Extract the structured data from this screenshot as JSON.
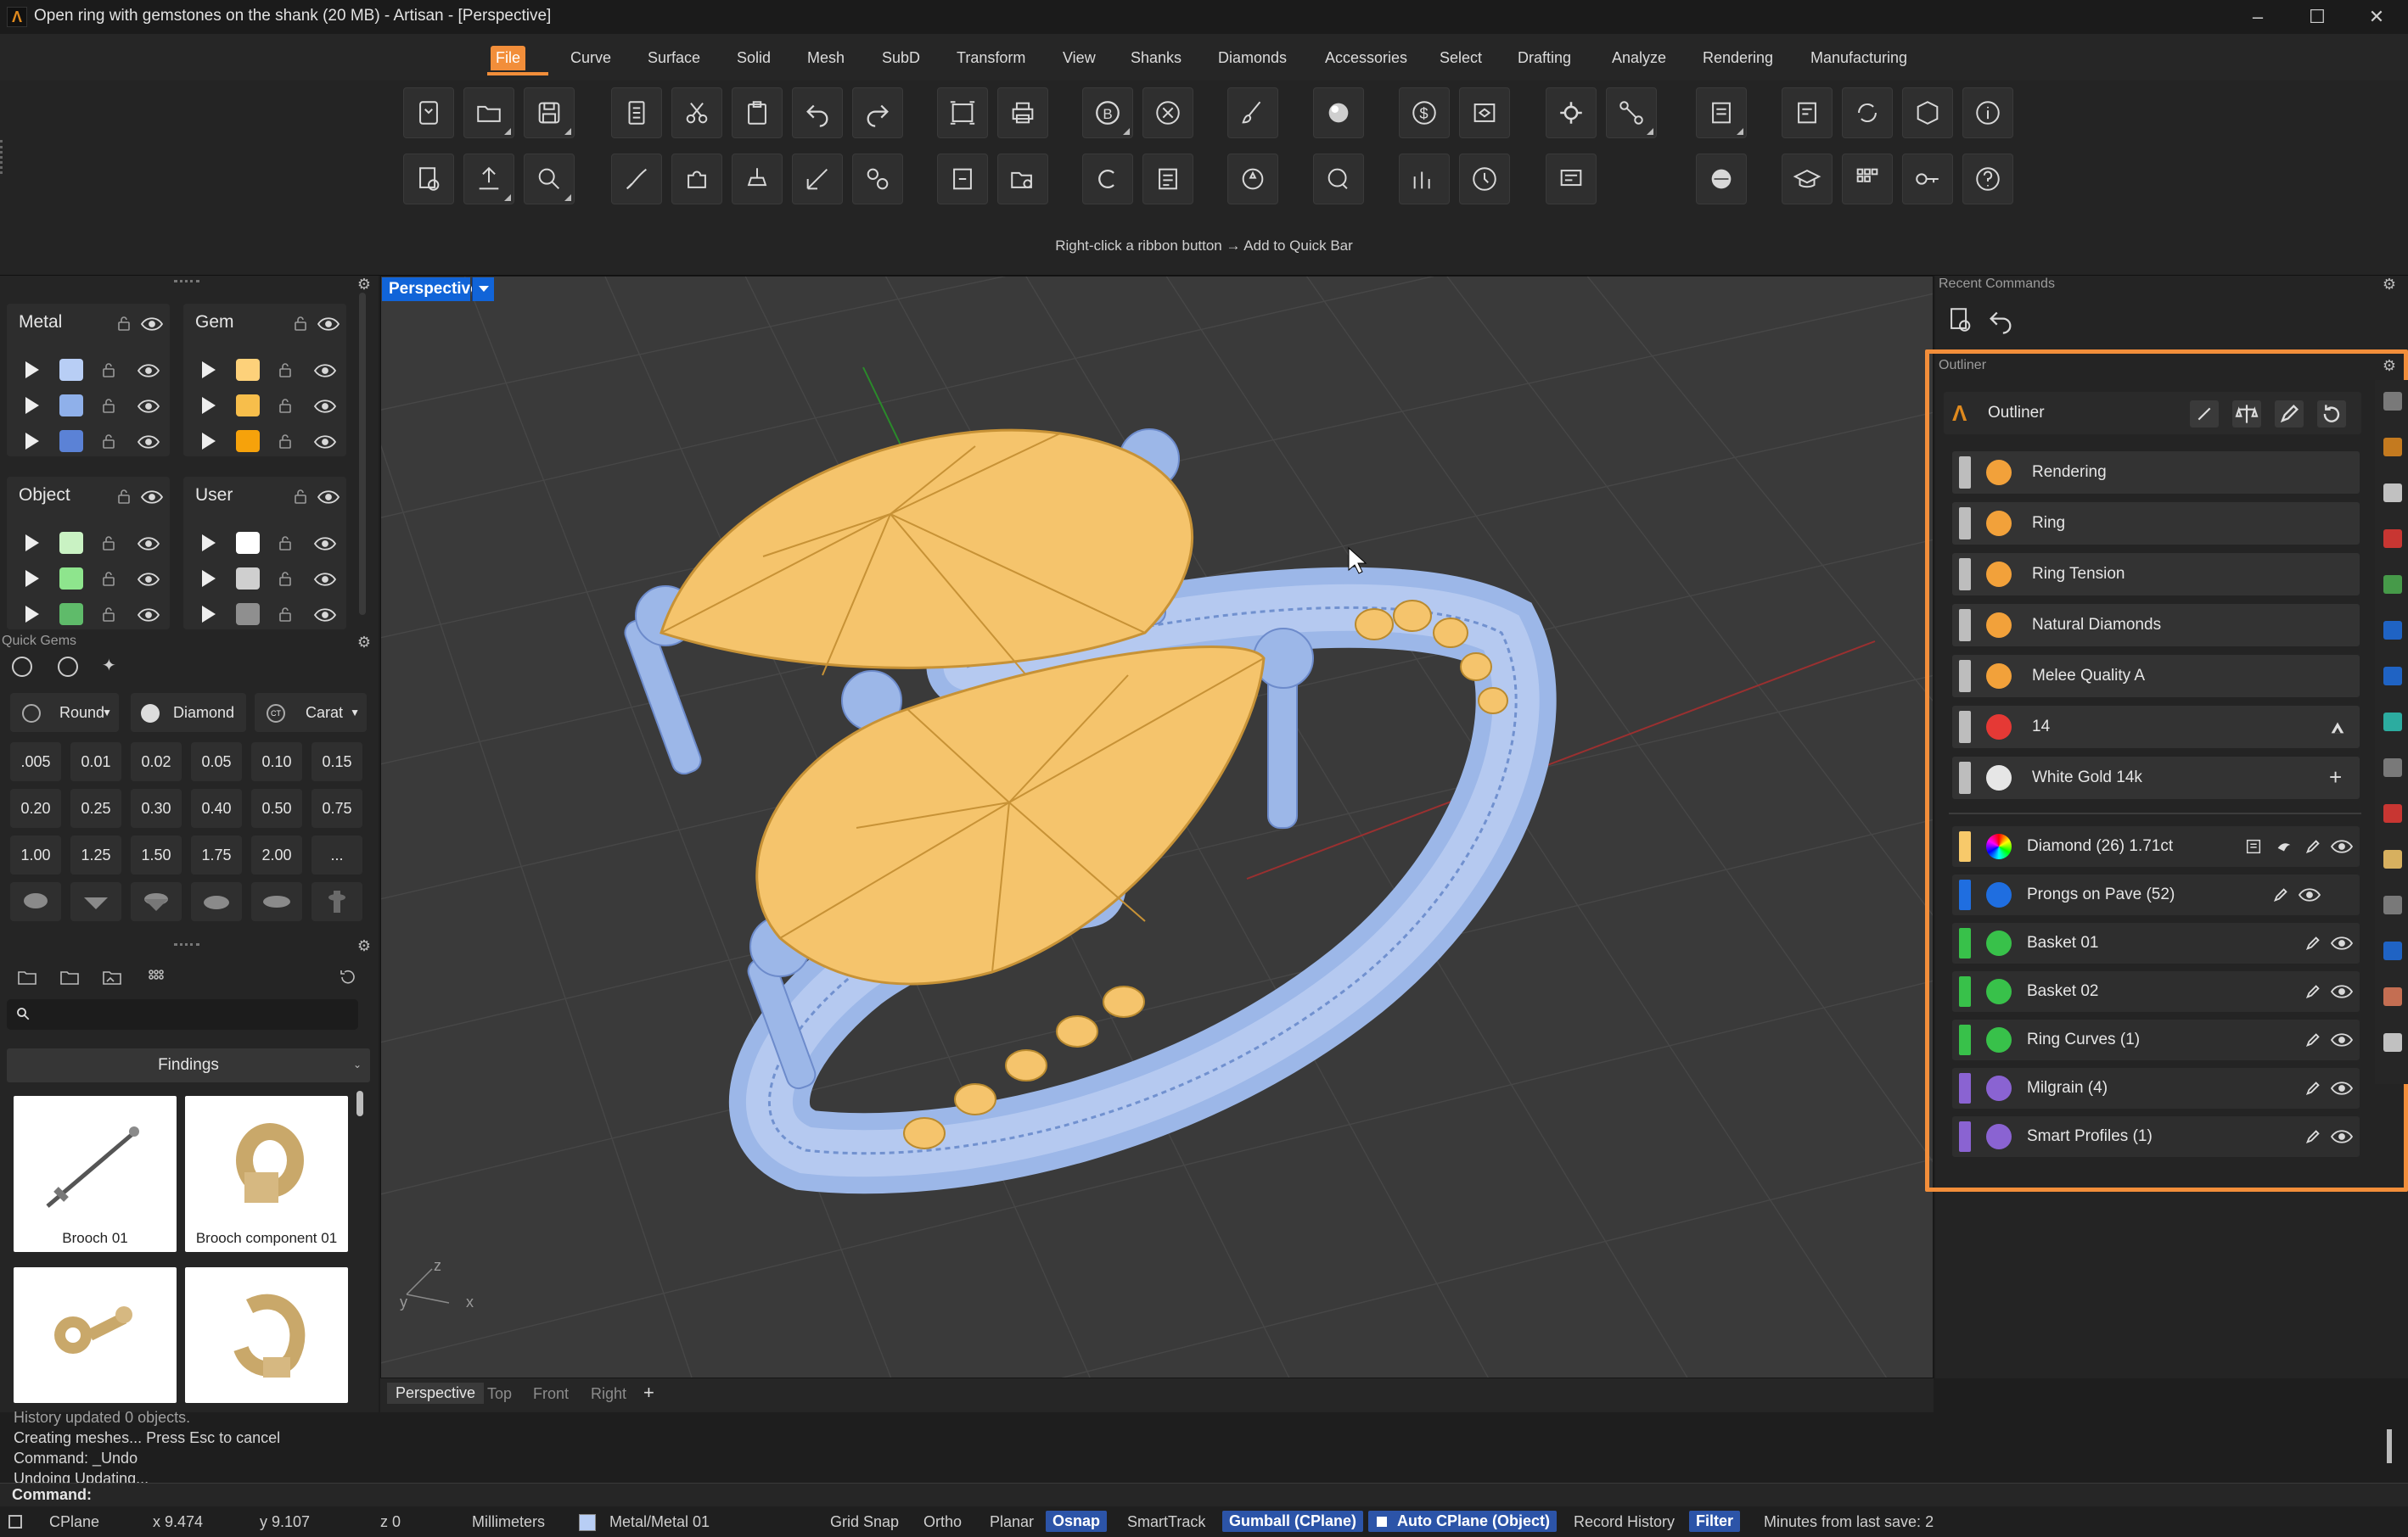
{
  "window": {
    "title": "Open ring with gemstones on the shank (20 MB) - Artisan - [Perspective]",
    "app_icon": "artisan-logo",
    "controls": [
      "minimize",
      "maximize",
      "close"
    ]
  },
  "menu": {
    "items": [
      "File",
      "Curve",
      "Surface",
      "Solid",
      "Mesh",
      "SubD",
      "Transform",
      "View",
      "Shanks",
      "Diamonds",
      "Accessories",
      "Select",
      "Drafting",
      "Analyze",
      "Rendering",
      "Manufacturing"
    ],
    "active": "File",
    "accent": "#f28e3a"
  },
  "ribbon": {
    "hint": "Right-click a ribbon button → Add to Quick Bar"
  },
  "layers": {
    "metal": {
      "title": "Metal",
      "swatches": [
        "#b8cef5",
        "#8fb0ea",
        "#5b82d6"
      ]
    },
    "gem": {
      "title": "Gem",
      "swatches": [
        "#fdd17a",
        "#f7be4b",
        "#f6a20b"
      ]
    },
    "object": {
      "title": "Object",
      "swatches": [
        "#c9f2c3",
        "#8ee58d",
        "#5fbb6a"
      ]
    },
    "user": {
      "title": "User",
      "swatches": [
        "#ffffff",
        "#cfcfcf",
        "#8f8f8f"
      ]
    }
  },
  "quick_gems": {
    "title": "Quick Gems",
    "shape": "Round",
    "material": "Diamond",
    "unit": "Carat",
    "sizes": [
      ".005",
      "0.01",
      "0.02",
      "0.05",
      "0.10",
      "0.15",
      "0.20",
      "0.25",
      "0.30",
      "0.40",
      "0.50",
      "0.75",
      "1.00",
      "1.25",
      "1.50",
      "1.75",
      "2.00",
      "..."
    ]
  },
  "library": {
    "category": "Findings",
    "search_placeholder": "",
    "items": [
      "Brooch 01",
      "Brooch component 01"
    ]
  },
  "viewport": {
    "name": "Perspective",
    "tabs": [
      "Perspective",
      "Top",
      "Front",
      "Right"
    ],
    "add_tab": "+",
    "axis_labels": {
      "x": "x",
      "y": "y",
      "z": "z"
    }
  },
  "recent_commands": {
    "title": "Recent Commands"
  },
  "outliner": {
    "title": "Outliner",
    "header_label": "Outliner",
    "highlight": "#f28e3a",
    "properties": [
      {
        "label": "Rendering",
        "icon": "palette-icon",
        "color": "#f2a13a"
      },
      {
        "label": "Ring",
        "icon": "ring-icon",
        "color": "#f2a13a"
      },
      {
        "label": "Ring Tension",
        "icon": "tension-icon",
        "color": "#f2a13a"
      },
      {
        "label": "Natural Diamonds",
        "icon": "diamond-icon",
        "color": "#f2a13a"
      },
      {
        "label": "Melee Quality A",
        "icon": "quality-icon",
        "color": "#f2a13a"
      },
      {
        "label": "14",
        "icon": "flag-icon",
        "color": "#e53935"
      },
      {
        "label": "White Gold 14k",
        "icon": "metal-icon",
        "color": "#e6e6e6"
      }
    ],
    "objects": [
      {
        "label": "Diamond (26) 1.71ct",
        "bar": "#f7c96a"
      },
      {
        "label": "Prongs on Pave (52)",
        "bar": "#1f6ee0"
      },
      {
        "label": "Basket 01",
        "bar": "#38c14a"
      },
      {
        "label": "Basket 02",
        "bar": "#38c14a"
      },
      {
        "label": "Ring Curves (1)",
        "bar": "#38c14a"
      },
      {
        "label": "Milgrain (4)",
        "bar": "#8a63d2"
      },
      {
        "label": "Smart Profiles (1)",
        "bar": "#8a63d2"
      }
    ]
  },
  "command_history": [
    "History updated 0 objects.",
    "Creating meshes... Press Esc to cancel",
    "Command: _Undo",
    "Undoing Updating..."
  ],
  "command_prompt": "Command:",
  "status": {
    "cplane": "CPlane",
    "x": "x 9.474",
    "y": "y 9.107",
    "z": "z 0",
    "units": "Millimeters",
    "layer": "Metal/Metal 01",
    "layer_color": "#b8cef5",
    "toggles": [
      {
        "label": "Grid Snap",
        "on": false
      },
      {
        "label": "Ortho",
        "on": false
      },
      {
        "label": "Planar",
        "on": false
      },
      {
        "label": "Osnap",
        "on": true
      },
      {
        "label": "SmartTrack",
        "on": false
      },
      {
        "label": "Gumball (CPlane)",
        "on": true
      },
      {
        "label": "Auto CPlane (Object)",
        "on": true
      },
      {
        "label": "Record History",
        "on": false
      },
      {
        "label": "Filter",
        "on": true
      }
    ],
    "save_info": "Minutes from last save: 2"
  }
}
